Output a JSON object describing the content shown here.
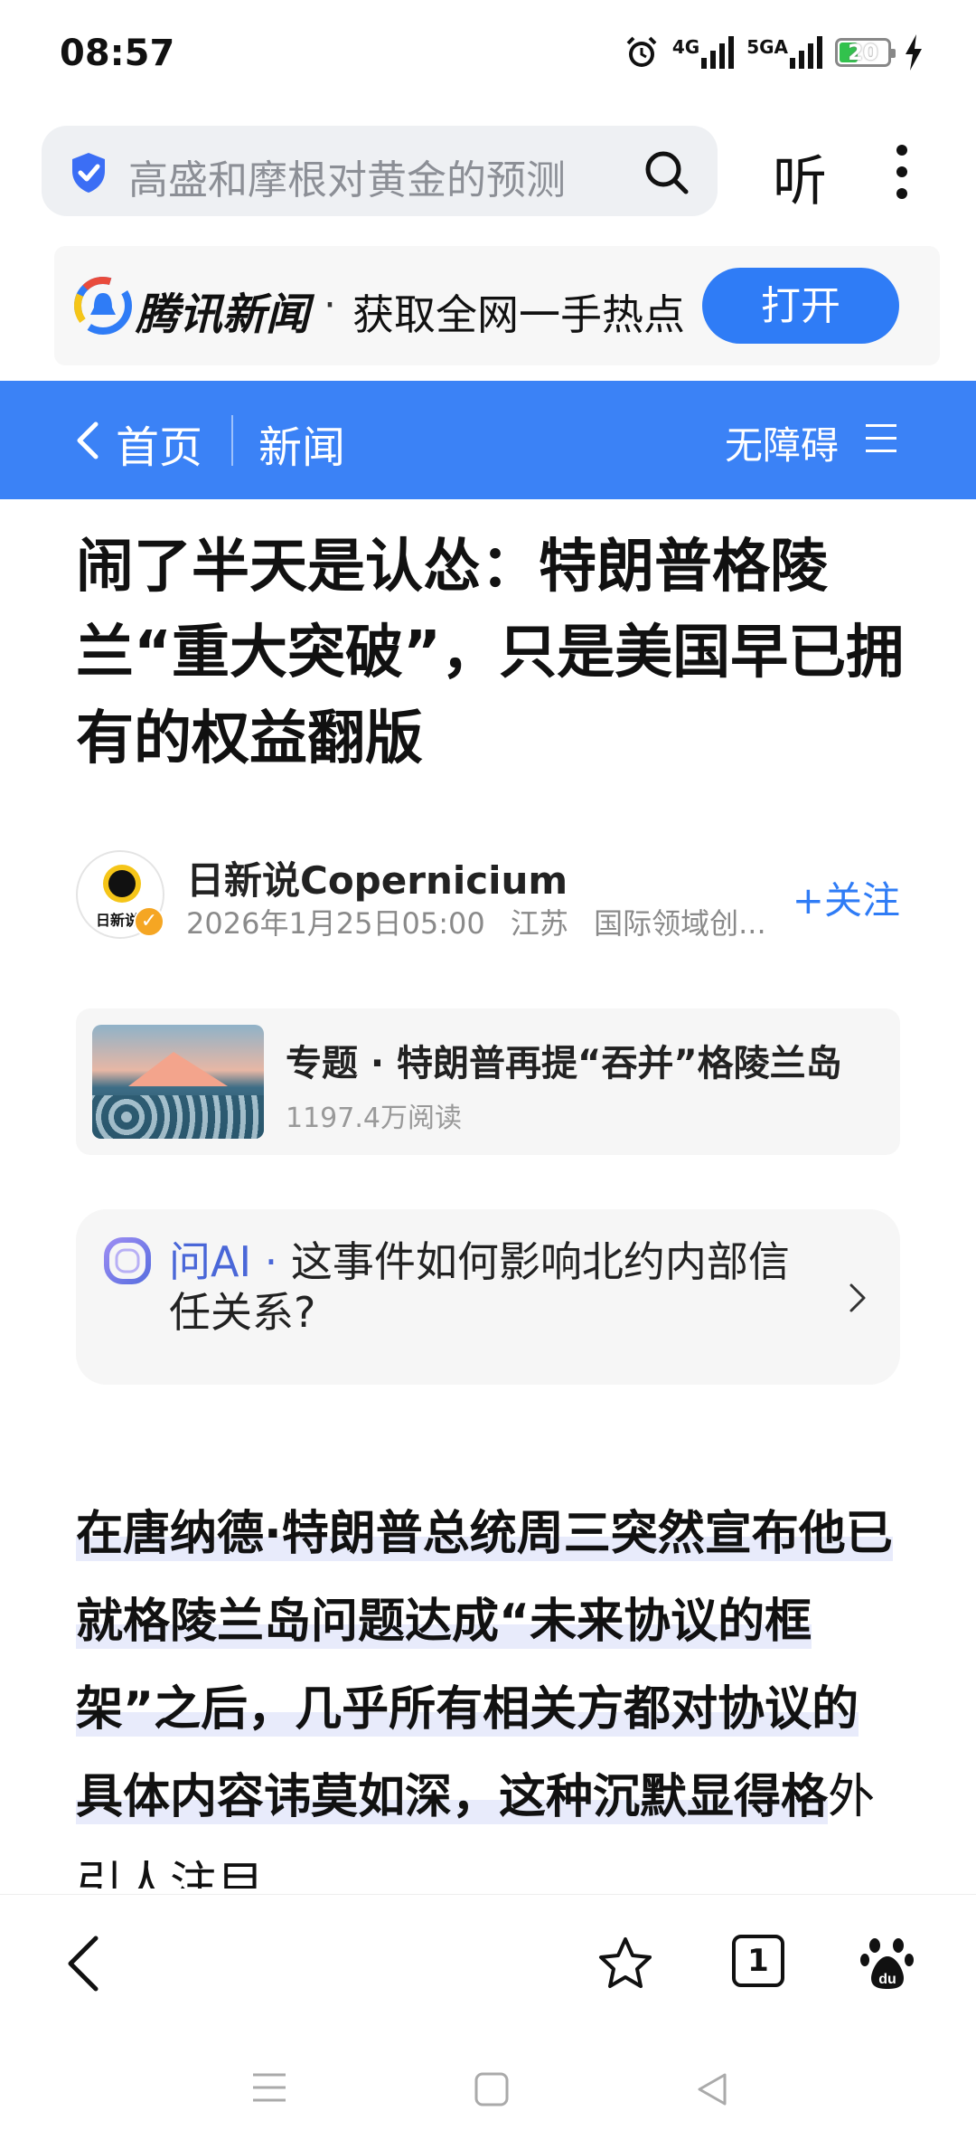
{
  "status_bar": {
    "time": "08:57",
    "network_1": "4G",
    "network_2": "5GA",
    "battery": "20"
  },
  "search": {
    "placeholder": "高盛和摩根对黄金的预测",
    "listen_label": "听"
  },
  "banner": {
    "brand": "腾讯新闻",
    "separator": "·",
    "slogan": "获取全网一手热点",
    "open_label": "打开"
  },
  "nav": {
    "home_label": "首页",
    "section_label": "新闻",
    "accessibility_label": "无障碍"
  },
  "article": {
    "title": "闹了半天是认怂：特朗普格陵兰“重大突破”，只是美国早已拥有的权益翻版",
    "author": {
      "name": "日新说Copernicium",
      "date": "2026年1月25日05:00",
      "location": "江苏",
      "tag": "国际领域创...",
      "follow_label": "关注",
      "follow_plus": "+"
    },
    "topic": {
      "title": "专题 · 特朗普再提“吞并”格陵兰岛",
      "reads": "1197.4万阅读"
    },
    "ask_ai": {
      "prefix": "问AI",
      "separator": " · ",
      "question": "这事件如何影响北约内部信任关系?"
    },
    "body_bold": "在唐纳德·特朗普总统周三突然宣布他已就格陵兰岛问题达成“未来协议的框架”之后，几乎所有相关方都对协议的具体内容讳莫如深，这种沉默显得格",
    "body_rest": "外引人注目"
  },
  "toolbar": {
    "tabs_count": "1"
  },
  "colors": {
    "accent_blue": "#3b82f6",
    "open_button": "#2f7cf6",
    "ai_blue": "#4a67d8",
    "battery_green": "#32c24d"
  }
}
